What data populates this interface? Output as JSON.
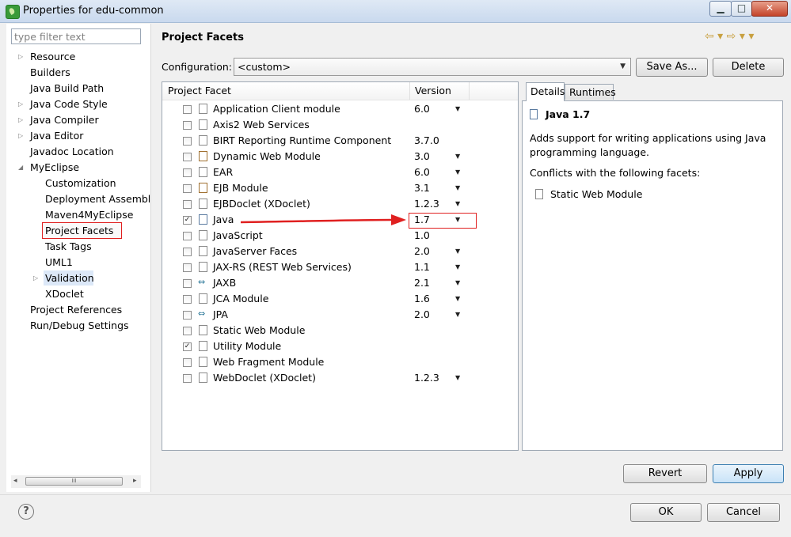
{
  "window": {
    "title": "Properties for edu-common",
    "minimize": "▁",
    "maximize": "□",
    "close": "✕"
  },
  "filter": {
    "placeholder": "type filter text"
  },
  "tree": {
    "items": [
      {
        "label": "Resource",
        "arrow": "▷"
      },
      {
        "label": "Builders"
      },
      {
        "label": "Java Build Path"
      },
      {
        "label": "Java Code Style",
        "arrow": "▷"
      },
      {
        "label": "Java Compiler",
        "arrow": "▷"
      },
      {
        "label": "Java Editor",
        "arrow": "▷"
      },
      {
        "label": "Javadoc Location"
      },
      {
        "label": "MyEclipse",
        "arrow": "◢"
      },
      {
        "label": "Customization"
      },
      {
        "label": "Deployment Assembl"
      },
      {
        "label": "Maven4MyEclipse"
      },
      {
        "label": "Project Facets"
      },
      {
        "label": "Task Tags"
      },
      {
        "label": "UML1"
      },
      {
        "label": "Validation",
        "arrow": "▷"
      },
      {
        "label": "XDoclet"
      },
      {
        "label": "Project References"
      },
      {
        "label": "Run/Debug Settings"
      }
    ],
    "scroll_left": "◂",
    "scroll_right": "▸",
    "scroll_grip": "III"
  },
  "header": {
    "title": "Project Facets",
    "nav": "⇦ ▾  ⇨ ▾ ▾"
  },
  "configuration": {
    "label": "Configuration:",
    "value": "<custom>",
    "arrow": "▼",
    "save_as": "Save As...",
    "delete": "Delete"
  },
  "table": {
    "col_facet": "Project Facet",
    "col_version": "Version",
    "rows": [
      {
        "name": "Application Client module",
        "version": "6.0",
        "dropdown": "▼",
        "checked": ""
      },
      {
        "name": "Axis2 Web Services",
        "version": "",
        "dropdown": "",
        "checked": ""
      },
      {
        "name": "BIRT Reporting Runtime Component",
        "version": "3.7.0",
        "dropdown": "",
        "checked": ""
      },
      {
        "name": "Dynamic Web Module",
        "version": "3.0",
        "dropdown": "▼",
        "checked": ""
      },
      {
        "name": "EAR",
        "version": "6.0",
        "dropdown": "▼",
        "checked": ""
      },
      {
        "name": "EJB Module",
        "version": "3.1",
        "dropdown": "▼",
        "checked": ""
      },
      {
        "name": "EJBDoclet (XDoclet)",
        "version": "1.2.3",
        "dropdown": "▼",
        "checked": ""
      },
      {
        "name": "Java",
        "version": "1.7",
        "dropdown": "▼",
        "checked": "✓"
      },
      {
        "name": "JavaScript",
        "version": "1.0",
        "dropdown": "",
        "checked": ""
      },
      {
        "name": "JavaServer Faces",
        "version": "2.0",
        "dropdown": "▼",
        "checked": ""
      },
      {
        "name": "JAX-RS (REST Web Services)",
        "version": "1.1",
        "dropdown": "▼",
        "checked": ""
      },
      {
        "name": "JAXB",
        "version": "2.1",
        "dropdown": "▼",
        "checked": ""
      },
      {
        "name": "JCA Module",
        "version": "1.6",
        "dropdown": "▼",
        "checked": ""
      },
      {
        "name": "JPA",
        "version": "2.0",
        "dropdown": "▼",
        "checked": ""
      },
      {
        "name": "Static Web Module",
        "version": "",
        "dropdown": "",
        "checked": ""
      },
      {
        "name": "Utility Module",
        "version": "",
        "dropdown": "",
        "checked": "✓"
      },
      {
        "name": "Web Fragment Module",
        "version": "",
        "dropdown": "",
        "checked": ""
      },
      {
        "name": "WebDoclet (XDoclet)",
        "version": "1.2.3",
        "dropdown": "▼",
        "checked": ""
      }
    ]
  },
  "details": {
    "tab_details": "Details",
    "tab_runtimes": "Runtimes",
    "facet_title": "Java 1.7",
    "description": "Adds support for writing applications using Java programming language.",
    "conflicts_label": "Conflicts with the following facets:",
    "conflict_item": "Static Web Module"
  },
  "buttons": {
    "revert": "Revert",
    "apply": "Apply",
    "ok": "OK",
    "cancel": "Cancel",
    "help": "?"
  },
  "colors": {
    "highlight_red": "#e02020",
    "selection_blue": "#dce8f8",
    "apply_border": "#3c7fb1"
  }
}
